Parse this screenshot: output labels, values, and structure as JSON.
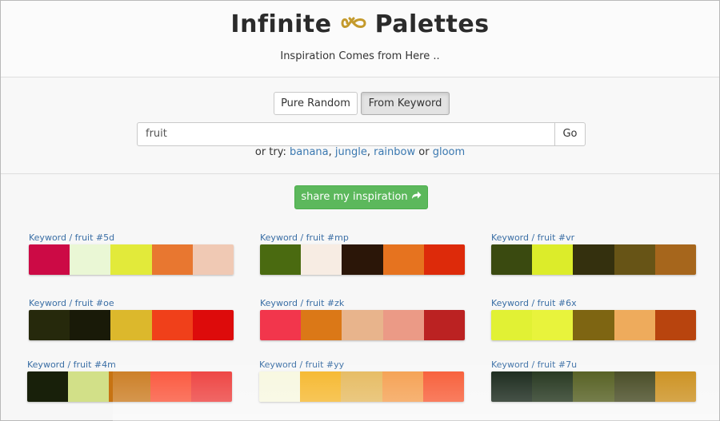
{
  "header": {
    "title_left": "Infinite",
    "title_right": "Palettes",
    "logo_icon": "infinity-icon",
    "logo_color": "#c49a2c",
    "subtitle": "Inspiration Comes from Here .."
  },
  "mode": {
    "random_label": "Pure Random",
    "keyword_label": "From Keyword",
    "active": "From Keyword"
  },
  "search": {
    "value": "fruit",
    "go_label": "Go"
  },
  "suggestions": {
    "prefix": "or try: ",
    "items": [
      "banana",
      "jungle",
      "rainbow",
      "gloom"
    ],
    "sep1": ", ",
    "sep2": ", ",
    "sep3": " or "
  },
  "share": {
    "label": "share my inspiration",
    "icon": "share-arrow-icon",
    "color": "#5cb85c"
  },
  "palettes": [
    {
      "label": "Keyword / fruit #5d",
      "colors": [
        "#cc0a45",
        "#eaf7d5",
        "#e2ea3a",
        "#e87730",
        "#f0c9b4"
      ]
    },
    {
      "label": "Keyword / fruit #mp",
      "colors": [
        "#4a6a10",
        "#f7ece3",
        "#2b1608",
        "#e6731f",
        "#dd2a0a"
      ]
    },
    {
      "label": "Keyword / fruit #vr",
      "colors": [
        "#3a4a10",
        "#dcec2a",
        "#34300e",
        "#675416",
        "#a6661c"
      ]
    },
    {
      "label": "Keyword / fruit #oe",
      "colors": [
        "#26290c",
        "#191a08",
        "#dcb82c",
        "#f0401a",
        "#dd0b0b"
      ]
    },
    {
      "label": "Keyword / fruit #zk",
      "colors": [
        "#f2364c",
        "#db7817",
        "#e8b48c",
        "#eb9a86",
        "#bb2222"
      ]
    },
    {
      "label": "Keyword / fruit #6x",
      "colors": [
        "#e1f134",
        "#e8f33c",
        "#7e6512",
        "#eeab5c",
        "#b8440e"
      ]
    },
    {
      "label": "Keyword / fruit #4m",
      "colors": [
        "#18200a",
        "#d2e088",
        "#c77312",
        "#fa4a2e",
        "#ec3432"
      ]
    },
    {
      "label": "Keyword / fruit #yy",
      "colors": [
        "#f7f7de",
        "#f5b320",
        "#e4b656",
        "#f49a46",
        "#f7522a"
      ]
    },
    {
      "label": "Keyword / fruit #7u",
      "colors": [
        "#08180a",
        "#13260c",
        "#47520f",
        "#383c12",
        "#c8880e"
      ]
    }
  ]
}
